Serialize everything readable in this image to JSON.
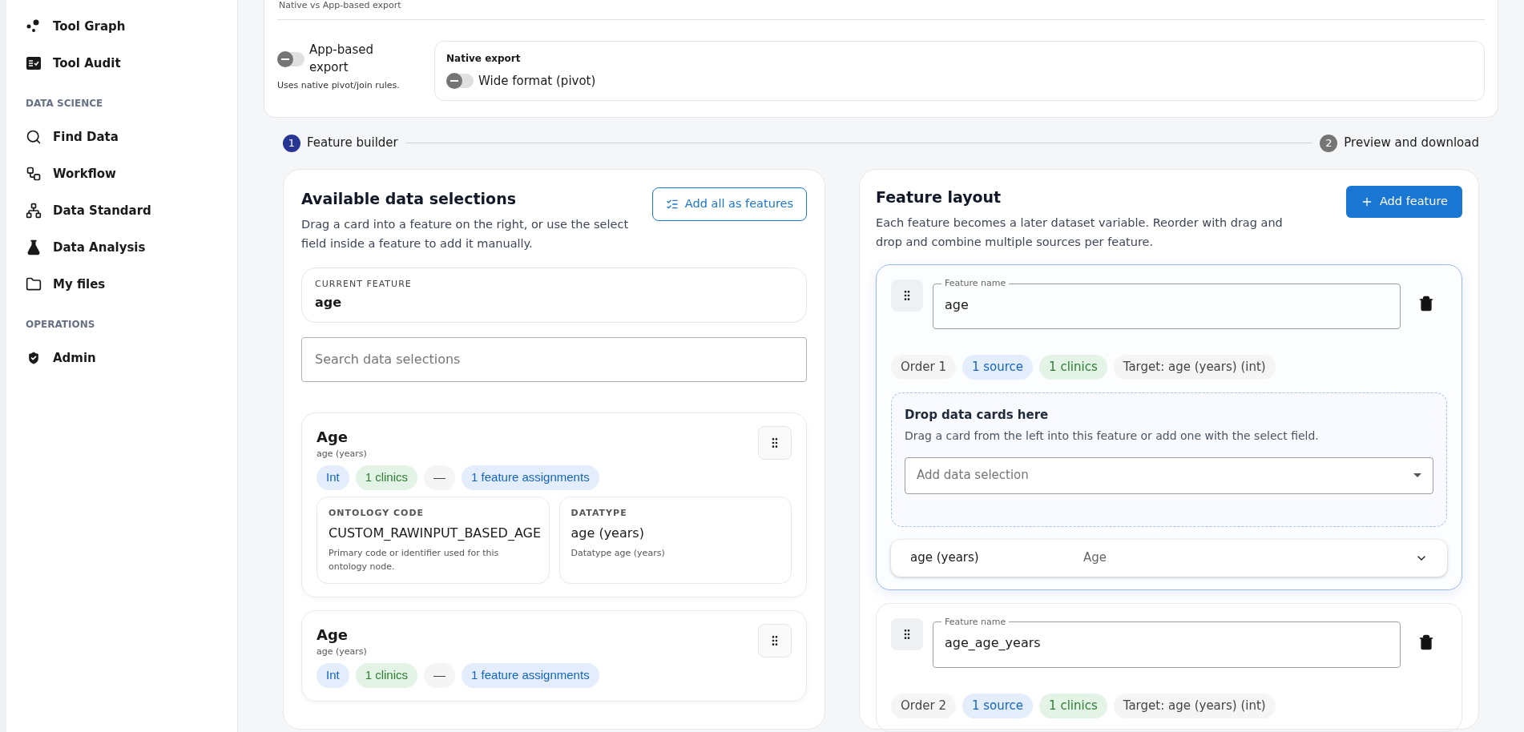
{
  "sidebar": {
    "sections": [
      {
        "items": [
          {
            "label": "Tool Graph"
          },
          {
            "label": "Tool Audit"
          }
        ]
      },
      {
        "heading": "DATA SCIENCE",
        "items": [
          {
            "label": "Find Data"
          },
          {
            "label": "Workflow"
          },
          {
            "label": "Data Standard"
          },
          {
            "label": "Data Analysis"
          },
          {
            "label": "My files"
          }
        ]
      },
      {
        "heading": "OPERATIONS",
        "items": [
          {
            "label": "Admin"
          }
        ]
      }
    ]
  },
  "export_settings": {
    "caption": "Native vs App-based export",
    "app_based": {
      "label": "App-based export",
      "on": false,
      "hint": "Uses native pivot/join rules."
    },
    "native": {
      "title": "Native export",
      "wide_format": {
        "label": "Wide format (pivot)",
        "on": false
      }
    }
  },
  "stepper": [
    {
      "number": "1",
      "label": "Feature builder",
      "selected": true
    },
    {
      "number": "2",
      "label": "Preview and download",
      "selected": false
    }
  ],
  "available": {
    "title": "Available data selections",
    "description": "Drag a card into a feature on the right, or use the select field inside a feature to add it manually.",
    "add_all_button": "Add all as features",
    "current_feature": {
      "label": "CURRENT FEATURE",
      "value": "age"
    },
    "search": {
      "placeholder": "Search data selections"
    },
    "cards": [
      {
        "title": "Age",
        "subtitle": "age (years)",
        "tags": [
          {
            "label": "Int",
            "kind": "blue"
          },
          {
            "label": "1 clinics",
            "kind": "green"
          },
          {
            "label": "—",
            "kind": "gray"
          },
          {
            "label": "1 feature assignments",
            "kind": "blue"
          }
        ],
        "fields": [
          {
            "label": "ONTOLOGY CODE",
            "value": "CUSTOM_RAWINPUT_BASED_AGE",
            "hint": "Primary code or identifier used for this ontology node."
          },
          {
            "label": "DATATYPE",
            "value": "age (years)",
            "hint": "Datatype age (years)"
          }
        ]
      },
      {
        "title": "Age",
        "subtitle": "age (years)",
        "tags": [
          {
            "label": "Int",
            "kind": "blue"
          },
          {
            "label": "1 clinics",
            "kind": "green"
          },
          {
            "label": "—",
            "kind": "gray"
          },
          {
            "label": "1 feature assignments",
            "kind": "blue"
          }
        ]
      }
    ]
  },
  "layout": {
    "title": "Feature layout",
    "description": "Each feature becomes a later dataset variable. Reorder with drag and drop and combine multiple sources per feature.",
    "add_button": "Add feature",
    "features": [
      {
        "selected": true,
        "name_label": "Feature name",
        "name": "age",
        "tags": [
          {
            "label": "Order 1",
            "kind": "gray"
          },
          {
            "label": "1 source",
            "kind": "blue"
          },
          {
            "label": "1 clinics",
            "kind": "green"
          },
          {
            "label": "Target: age (years) (int)",
            "kind": "gray"
          }
        ],
        "drop_zone": {
          "title": "Drop data cards here",
          "text": "Drag a card from the left into this feature or add one with the select field.",
          "placeholder": "Add data selection"
        },
        "sources": [
          {
            "value": "age (years)",
            "label": "Age"
          }
        ]
      },
      {
        "selected": false,
        "name_label": "Feature name",
        "name": "age_age_years",
        "tags": [
          {
            "label": "Order 2",
            "kind": "gray"
          },
          {
            "label": "1 source",
            "kind": "blue"
          },
          {
            "label": "1 clinics",
            "kind": "green"
          },
          {
            "label": "Target: age (years) (int)",
            "kind": "gray"
          }
        ]
      }
    ]
  }
}
